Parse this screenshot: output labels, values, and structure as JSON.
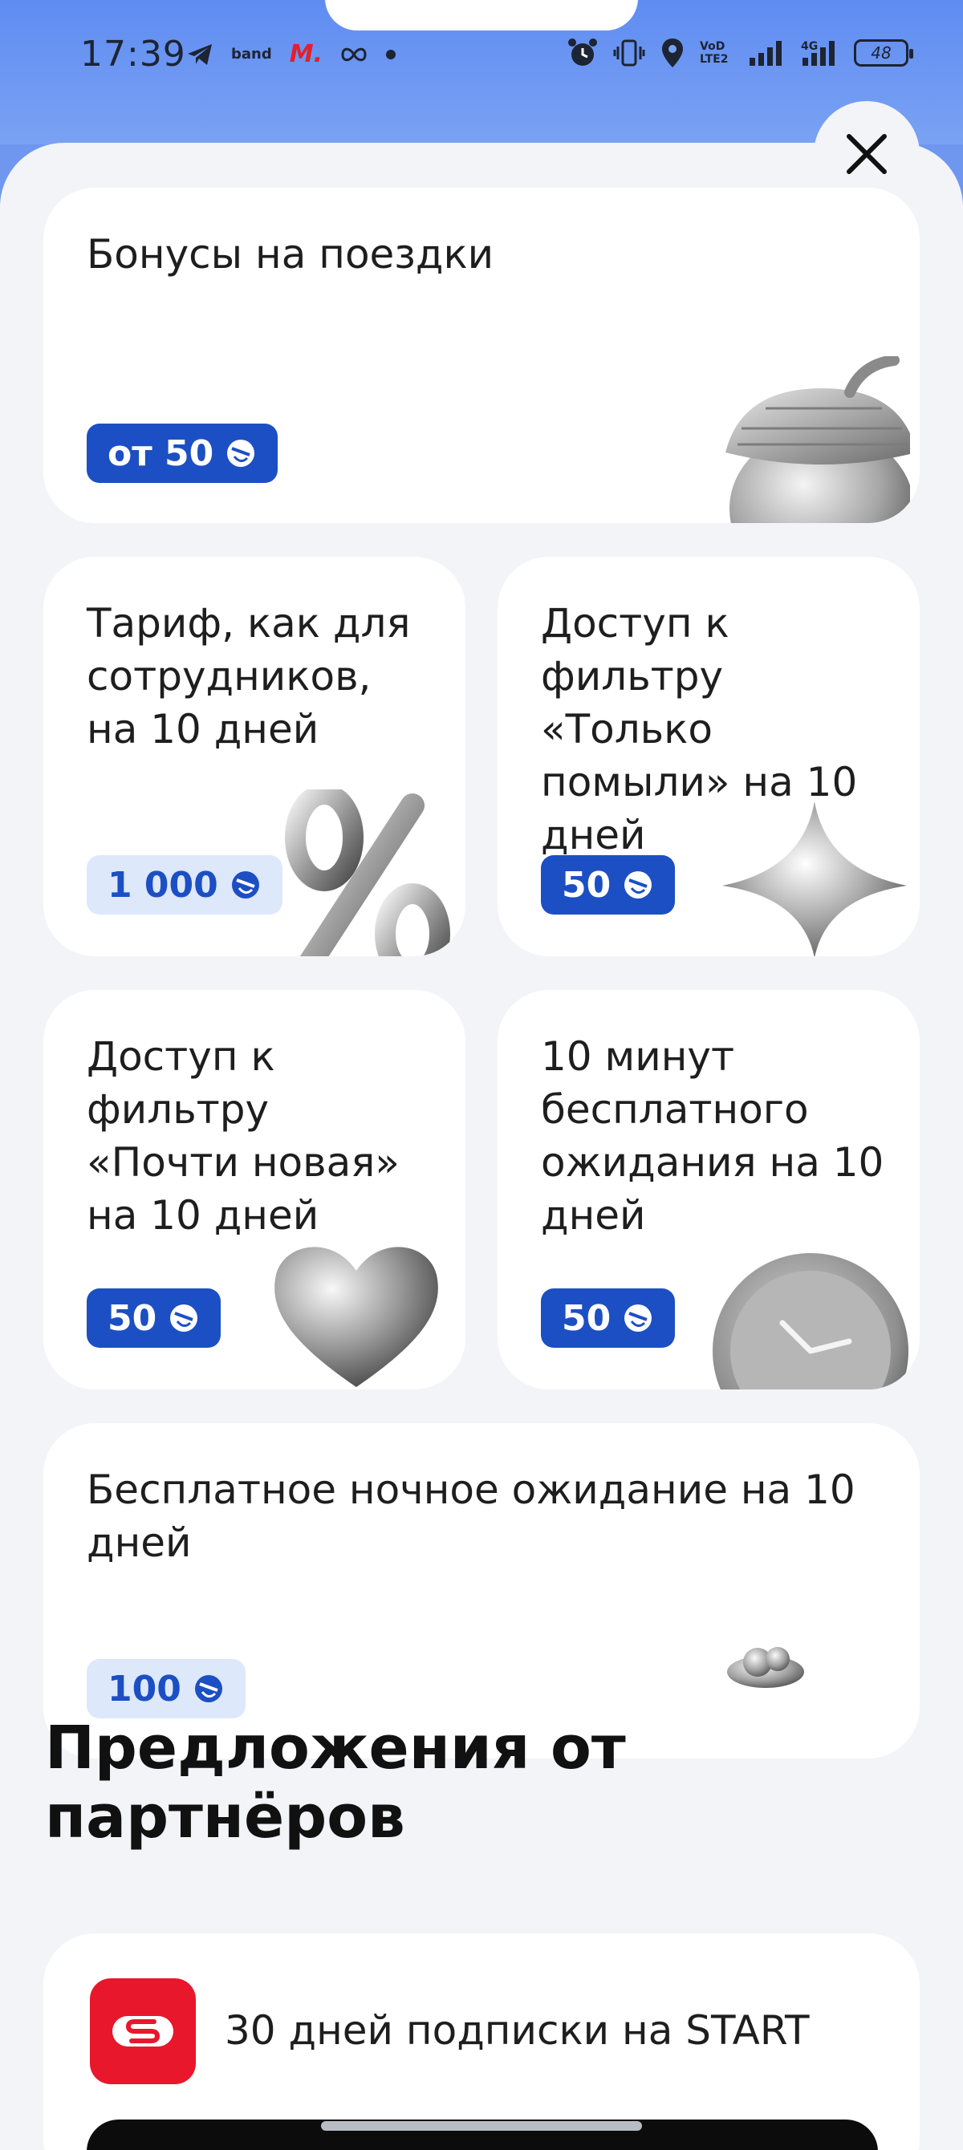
{
  "status_bar": {
    "time": "17:39",
    "left_icons": [
      "telegram-icon",
      "band-icon",
      "m-icon",
      "infinity-icon",
      "dot-icon"
    ],
    "band_label": "band",
    "m_label": "M.",
    "volte_label": "VoD LTE2",
    "net_label": "4G",
    "battery": "48"
  },
  "rewards": [
    {
      "title": "Бонусы на поездки",
      "badge": "от 50",
      "badge_style": "dark",
      "art": "acorn"
    },
    {
      "title": "Тариф, как для сотрудников, на 10 дней",
      "badge": "1 000",
      "badge_style": "light",
      "art": "percent"
    },
    {
      "title": "Доступ к фильтру «Только помыли» на 10 дней",
      "badge": "50",
      "badge_style": "dark",
      "art": "star"
    },
    {
      "title": "Доступ к фильтру «Почти новая» на 10 дней",
      "badge": "50",
      "badge_style": "dark",
      "art": "heart"
    },
    {
      "title": "10 минут бесплатного ожидания на 10 дней",
      "badge": "50",
      "badge_style": "dark",
      "art": "clock"
    },
    {
      "title": "Бесплатное ночное ожидание на 10 дней",
      "badge": "100",
      "badge_style": "light",
      "art": "moon"
    }
  ],
  "partners": {
    "section_title": "Предложения от партнёров",
    "items": [
      {
        "title": "30 дней подписки на START",
        "logo": "start-logo"
      }
    ]
  },
  "colors": {
    "accent": "#1c4fc3",
    "header_blue": "#6f97f0",
    "sheet_bg": "#f2f4f7",
    "partner_red": "#e8172b"
  }
}
